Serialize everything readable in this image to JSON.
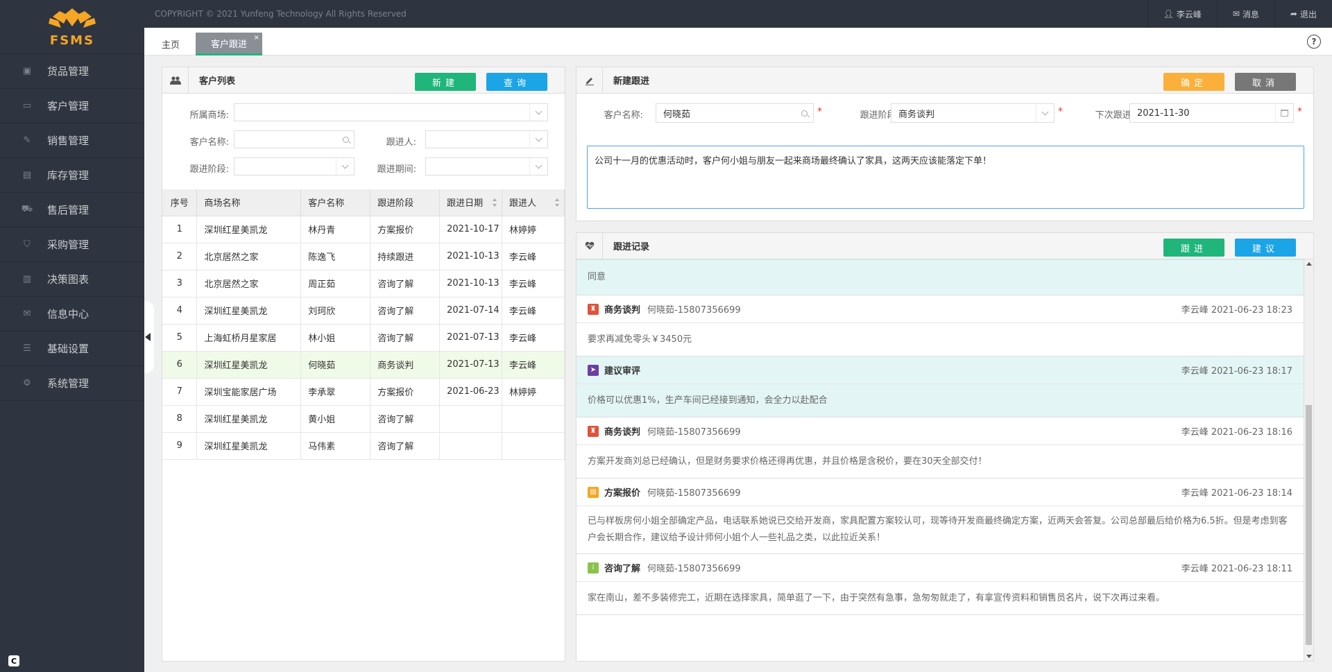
{
  "app": {
    "logo_text": "FSMS",
    "copyright": "COPYRIGHT © 2021 Yunfeng Technology All Rights Reserved"
  },
  "topbar": {
    "user": "李云峰",
    "messages": "消息",
    "logout": "退出"
  },
  "sidebar": {
    "items": [
      {
        "label": "货品管理",
        "icon": "box-icon"
      },
      {
        "label": "客户管理",
        "icon": "id-card-icon"
      },
      {
        "label": "销售管理",
        "icon": "edit-icon"
      },
      {
        "label": "库存管理",
        "icon": "warehouse-icon"
      },
      {
        "label": "售后管理",
        "icon": "truck-icon"
      },
      {
        "label": "采购管理",
        "icon": "cart-icon"
      },
      {
        "label": "决策图表",
        "icon": "bar-chart-icon"
      },
      {
        "label": "信息中心",
        "icon": "envelope-icon"
      },
      {
        "label": "基础设置",
        "icon": "sliders-icon"
      },
      {
        "label": "系统管理",
        "icon": "gear-icon"
      }
    ],
    "badge": "C"
  },
  "tabs": {
    "home": "主页",
    "active": "客户跟进",
    "close": "×",
    "help": "?"
  },
  "customer_list": {
    "title": "客户列表",
    "new_btn": "新建",
    "query_btn": "查询",
    "filters": {
      "mall_label": "所属商场:",
      "name_label": "客户名称:",
      "follower_label": "跟进人:",
      "stage_label": "跟进阶段:",
      "period_label": "跟进期间:"
    },
    "columns": [
      "序号",
      "商场名称",
      "客户名称",
      "跟进阶段",
      "跟进日期",
      "跟进人"
    ],
    "rows": [
      [
        "1",
        "深圳红星美凯龙",
        "林丹青",
        "方案报价",
        "2021-10-17",
        "林婷婷"
      ],
      [
        "2",
        "北京居然之家",
        "陈逸飞",
        "持续跟进",
        "2021-10-13",
        "李云峰"
      ],
      [
        "3",
        "北京居然之家",
        "周正茹",
        "咨询了解",
        "2021-10-13",
        "李云峰"
      ],
      [
        "4",
        "深圳红星美凯龙",
        "刘珂欣",
        "咨询了解",
        "2021-07-14",
        "李云峰"
      ],
      [
        "5",
        "上海虹桥月星家居",
        "林小姐",
        "咨询了解",
        "2021-07-13",
        "李云峰"
      ],
      [
        "6",
        "深圳红星美凯龙",
        "何晓茹",
        "商务谈判",
        "2021-07-13",
        "李云峰"
      ],
      [
        "7",
        "深圳宝能家居广场",
        "李承翠",
        "方案报价",
        "2021-06-23",
        "林婷婷"
      ],
      [
        "8",
        "深圳红星美凯龙",
        "黄小姐",
        "咨询了解",
        "",
        ""
      ],
      [
        "9",
        "深圳红星美凯龙",
        "马伟素",
        "咨询了解",
        "",
        ""
      ]
    ],
    "selected_row": 6
  },
  "new_followup": {
    "title": "新建跟进",
    "confirm_btn": "确定",
    "cancel_btn": "取消",
    "customer_label": "客户名称:",
    "customer_value": "何晓茹",
    "stage_label": "跟进阶段:",
    "stage_value": "商务谈判",
    "next_label": "下次跟进:",
    "next_value": "2021-11-30",
    "required": "*",
    "content": "公司十一月的优惠活动时，客户何小姐与朋友一起来商场最终确认了家具，这两天应该能落定下单！"
  },
  "records": {
    "title": "跟进记录",
    "follow_btn": "跟进",
    "suggest_btn": "建议",
    "top_body": "同意",
    "items": [
      {
        "stage": "商务谈判",
        "who": "何晓茹-15807356699",
        "time": "李云峰 2021-06-23 18:23",
        "body": "要求再减免零头￥3450元",
        "color": "#e0533a",
        "glyph": "♜",
        "light": false
      },
      {
        "stage": "建议审评",
        "who": "",
        "time": "李云峰 2021-06-23 18:17",
        "body": "价格可以优惠1%，生产车间已经接到通知，会全力以赴配合",
        "color": "#6b3fa0",
        "glyph": "➤",
        "light": true
      },
      {
        "stage": "商务谈判",
        "who": "何晓茹-15807356699",
        "time": "李云峰 2021-06-23 18:16",
        "body": "方案开发商刘总已经确认，但是财务要求价格还得再优惠，并且价格是含税价，要在30天全部交付！",
        "color": "#e0533a",
        "glyph": "♜",
        "light": false
      },
      {
        "stage": "方案报价",
        "who": "何晓茹-15807356699",
        "time": "李云峰 2021-06-23 18:14",
        "body": "已与样板房何小姐全部确定产品，电话联系她说已交给开发商，家具配置方案较认可，现等待开发商最终确定方案，近两天会答复。公司总部最后给价格为6.5折。但是考虑到客户会长期合作，建议给予设计师何小姐个人一些礼品之类，以此拉近关系！",
        "color": "#f5a623",
        "glyph": "▤",
        "light": false
      },
      {
        "stage": "咨询了解",
        "who": "何晓茹-15807356699",
        "time": "李云峰 2021-06-23 18:11",
        "body": "家在南山，差不多装修完工，近期在选择家具，简单逛了一下，由于突然有急事，急匆匆就走了，有拿宣传资料和销售员名片，说下次再过来看。",
        "color": "#8bc34a",
        "glyph": "i",
        "light": false
      }
    ]
  }
}
